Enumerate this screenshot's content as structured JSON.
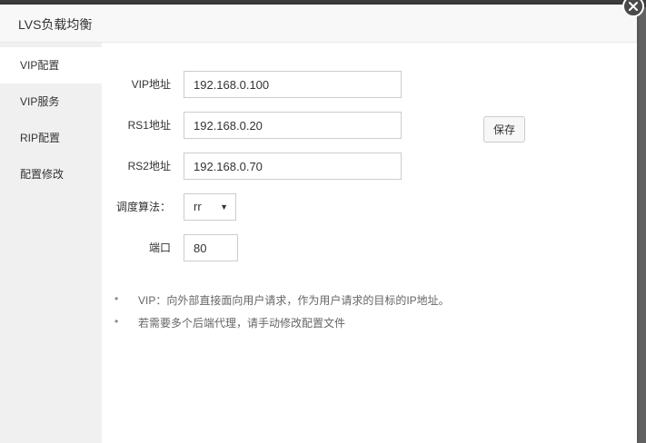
{
  "modal": {
    "title": "LVS负载均衡",
    "close_icon": "close-icon"
  },
  "sidebar": {
    "items": [
      {
        "label": "VIP配置",
        "active": true
      },
      {
        "label": "VIP服务",
        "active": false
      },
      {
        "label": "RIP配置",
        "active": false
      },
      {
        "label": "配置修改",
        "active": false
      }
    ]
  },
  "form": {
    "vip": {
      "label": "VIP地址",
      "value": "192.168.0.100"
    },
    "rs1": {
      "label": "RS1地址",
      "value": "192.168.0.20"
    },
    "rs2": {
      "label": "RS2地址",
      "value": "192.168.0.70"
    },
    "algorithm": {
      "label": "调度算法：",
      "value": "rr"
    },
    "port": {
      "label": "端口",
      "value": "80"
    },
    "save_label": "保存"
  },
  "notes": [
    "VIP：向外部直接面向用户请求，作为用户请求的目标的IP地址。",
    "若需要多个后端代理，请手动修改配置文件"
  ]
}
